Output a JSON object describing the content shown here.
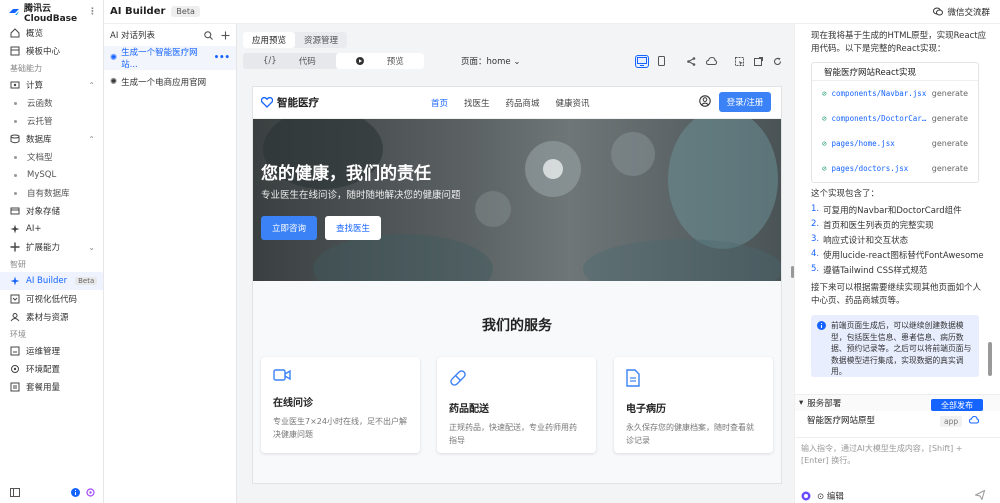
{
  "app": {
    "name": "腾讯云CloudBase",
    "more_icon": "more-vertical-icon"
  },
  "header": {
    "title": "AI Builder",
    "tag": "Beta",
    "wechat_label": "微信交流群"
  },
  "sidebar": {
    "items": [
      {
        "type": "item",
        "label": "概览",
        "icon": "home-icon"
      },
      {
        "type": "item",
        "label": "模板中心",
        "icon": "template-icon"
      },
      {
        "type": "section",
        "label": "基础能力"
      },
      {
        "type": "item",
        "label": "计算",
        "icon": "compute-icon",
        "chevron": "expanded"
      },
      {
        "type": "sub",
        "label": "云函数"
      },
      {
        "type": "sub",
        "label": "云托管"
      },
      {
        "type": "item",
        "label": "数据库",
        "icon": "database-icon",
        "chevron": "expanded"
      },
      {
        "type": "sub",
        "label": "文档型"
      },
      {
        "type": "sub",
        "label": "MySQL"
      },
      {
        "type": "sub",
        "label": "自有数据库"
      },
      {
        "type": "item",
        "label": "对象存储",
        "icon": "storage-icon"
      },
      {
        "type": "item",
        "label": "AI+",
        "icon": "ai-icon"
      },
      {
        "type": "item",
        "label": "扩展能力",
        "icon": "extension-icon",
        "chevron": "collapsed"
      },
      {
        "type": "section",
        "label": "智研"
      },
      {
        "type": "item",
        "label": "AI Builder",
        "icon": "sparkle-icon",
        "active": true,
        "badge": "Beta"
      },
      {
        "type": "item",
        "label": "可视化低代码",
        "icon": "lowcode-icon"
      },
      {
        "type": "item",
        "label": "素材与资源",
        "icon": "assets-icon"
      },
      {
        "type": "section",
        "label": "环境"
      },
      {
        "type": "item",
        "label": "运维管理",
        "icon": "ops-icon"
      },
      {
        "type": "item",
        "label": "环境配置",
        "icon": "env-icon"
      },
      {
        "type": "item",
        "label": "套餐用量",
        "icon": "billing-icon"
      }
    ]
  },
  "chatlist": {
    "title": "AI 对话列表",
    "items": [
      {
        "label": "生成一个智能医疗网站...",
        "active": true
      },
      {
        "label": "生成一个电商应用官网",
        "active": false
      }
    ]
  },
  "preview": {
    "tabs": [
      {
        "label": "应用预览",
        "active": true
      },
      {
        "label": "资源管理",
        "active": false
      }
    ],
    "mode": {
      "code_label": "代码",
      "preview_label": "预览"
    },
    "page_label": "页面：home"
  },
  "site": {
    "brand": "智能医疗",
    "nav": [
      {
        "label": "首页",
        "active": true
      },
      {
        "label": "找医生",
        "active": false
      },
      {
        "label": "药品商城",
        "active": false
      },
      {
        "label": "健康资讯",
        "active": false
      }
    ],
    "login": "登录/注册",
    "hero": {
      "title": "您的健康，我们的责任",
      "subtitle": "专业医生在线问诊，随时随地解决您的健康问题",
      "btn_primary": "立即咨询",
      "btn_secondary": "查找医生"
    },
    "services_title": "我们的服务",
    "services": [
      {
        "icon": "video-icon",
        "title": "在线问诊",
        "desc": "专业医生7×24小时在线，足不出户解决健康问题"
      },
      {
        "icon": "pill-icon",
        "title": "药品配送",
        "desc": "正规药品，快速配送，专业药师用药指导"
      },
      {
        "icon": "document-icon",
        "title": "电子病历",
        "desc": "永久保存您的健康档案，随时查看就诊记录"
      }
    ]
  },
  "assistant": {
    "intro": "现在我将基于生成的HTML原型，实现React应用代码。以下是完整的React实现：",
    "code_title": "智能医疗网站React实现",
    "files": [
      {
        "path": "components/Navbar.jsx",
        "status": "generate"
      },
      {
        "path": "components/DoctorCar…",
        "status": "generate"
      },
      {
        "path": "pages/home.jsx",
        "status": "generate"
      },
      {
        "path": "pages/doctors.jsx",
        "status": "generate"
      }
    ],
    "features_title": "这个实现包含了：",
    "features": [
      "可复用的Navbar和DoctorCard组件",
      "首页和医生列表页的完整实现",
      "响应式设计和交互状态",
      "使用lucide-react图标替代FontAwesome",
      "遵循Tailwind CSS样式规范"
    ],
    "next": "接下来可以根据需要继续实现其他页面如个人中心页、药品商城页等。",
    "notice": "前端页面生成后，可以继续创建数据模型，包括医生信息、患者信息、病历数据、预约记录等。之后可以将前端页面与数据模型进行集成，实现数据的真实调用。"
  },
  "deploy": {
    "title": "服务部署",
    "publish": "全部发布",
    "name": "智能医疗网站原型",
    "badge": "app"
  },
  "input": {
    "placeholder": "输入指令，通过AI大模型生成内容，[Shift] + [Enter] 换行。",
    "edit_label": "编辑"
  },
  "colors": {
    "accent": "#1664ff",
    "button": "#3b82f6"
  }
}
